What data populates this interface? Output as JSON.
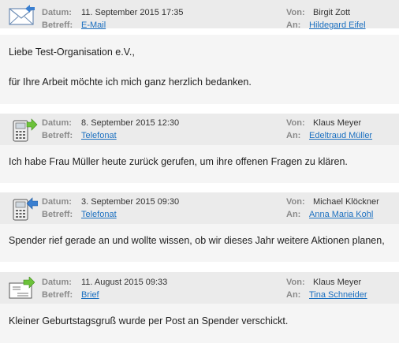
{
  "labels": {
    "datum": "Datum:",
    "betreff": "Betreff:",
    "von": "Von:",
    "an": "An:"
  },
  "entries": [
    {
      "icon": "envelope-incoming-icon",
      "datum": "11. September 2015 17:35",
      "betreff": "E-Mail",
      "von": "Birgit Zott",
      "an": "Hildegard Eifel",
      "text": [
        "Liebe Test-Organisation e.V.,",
        "für Ihre Arbeit möchte ich mich ganz herzlich bedanken."
      ]
    },
    {
      "icon": "phone-outgoing-icon",
      "datum": "8. September 2015 12:30",
      "betreff": "Telefonat",
      "von": "Klaus Meyer",
      "an": "Edeltraud Müller",
      "text": [
        "Ich habe Frau Müller heute zurück gerufen, um ihre offenen Fragen zu klären."
      ]
    },
    {
      "icon": "phone-incoming-icon",
      "datum": "3. September 2015 09:30",
      "betreff": "Telefonat",
      "von": "Michael Klöckner",
      "an": "Anna Maria Kohl",
      "text": [
        "Spender rief gerade an und wollte wissen, ob wir dieses Jahr weitere Aktionen planen,"
      ]
    },
    {
      "icon": "letter-outgoing-icon",
      "datum": "11. August 2015 09:33",
      "betreff": "Brief",
      "von": "Klaus Meyer",
      "an": "Tina Schneider",
      "text": [
        "Kleiner Geburtstagsgruß wurde per Post an Spender verschickt."
      ]
    }
  ],
  "colors": {
    "header_bg": "#ebebeb",
    "body_bg": "#f5f5f5",
    "link": "#1a6fc0",
    "arrow_in": "#3a7fd0",
    "arrow_out": "#6cc23a"
  }
}
